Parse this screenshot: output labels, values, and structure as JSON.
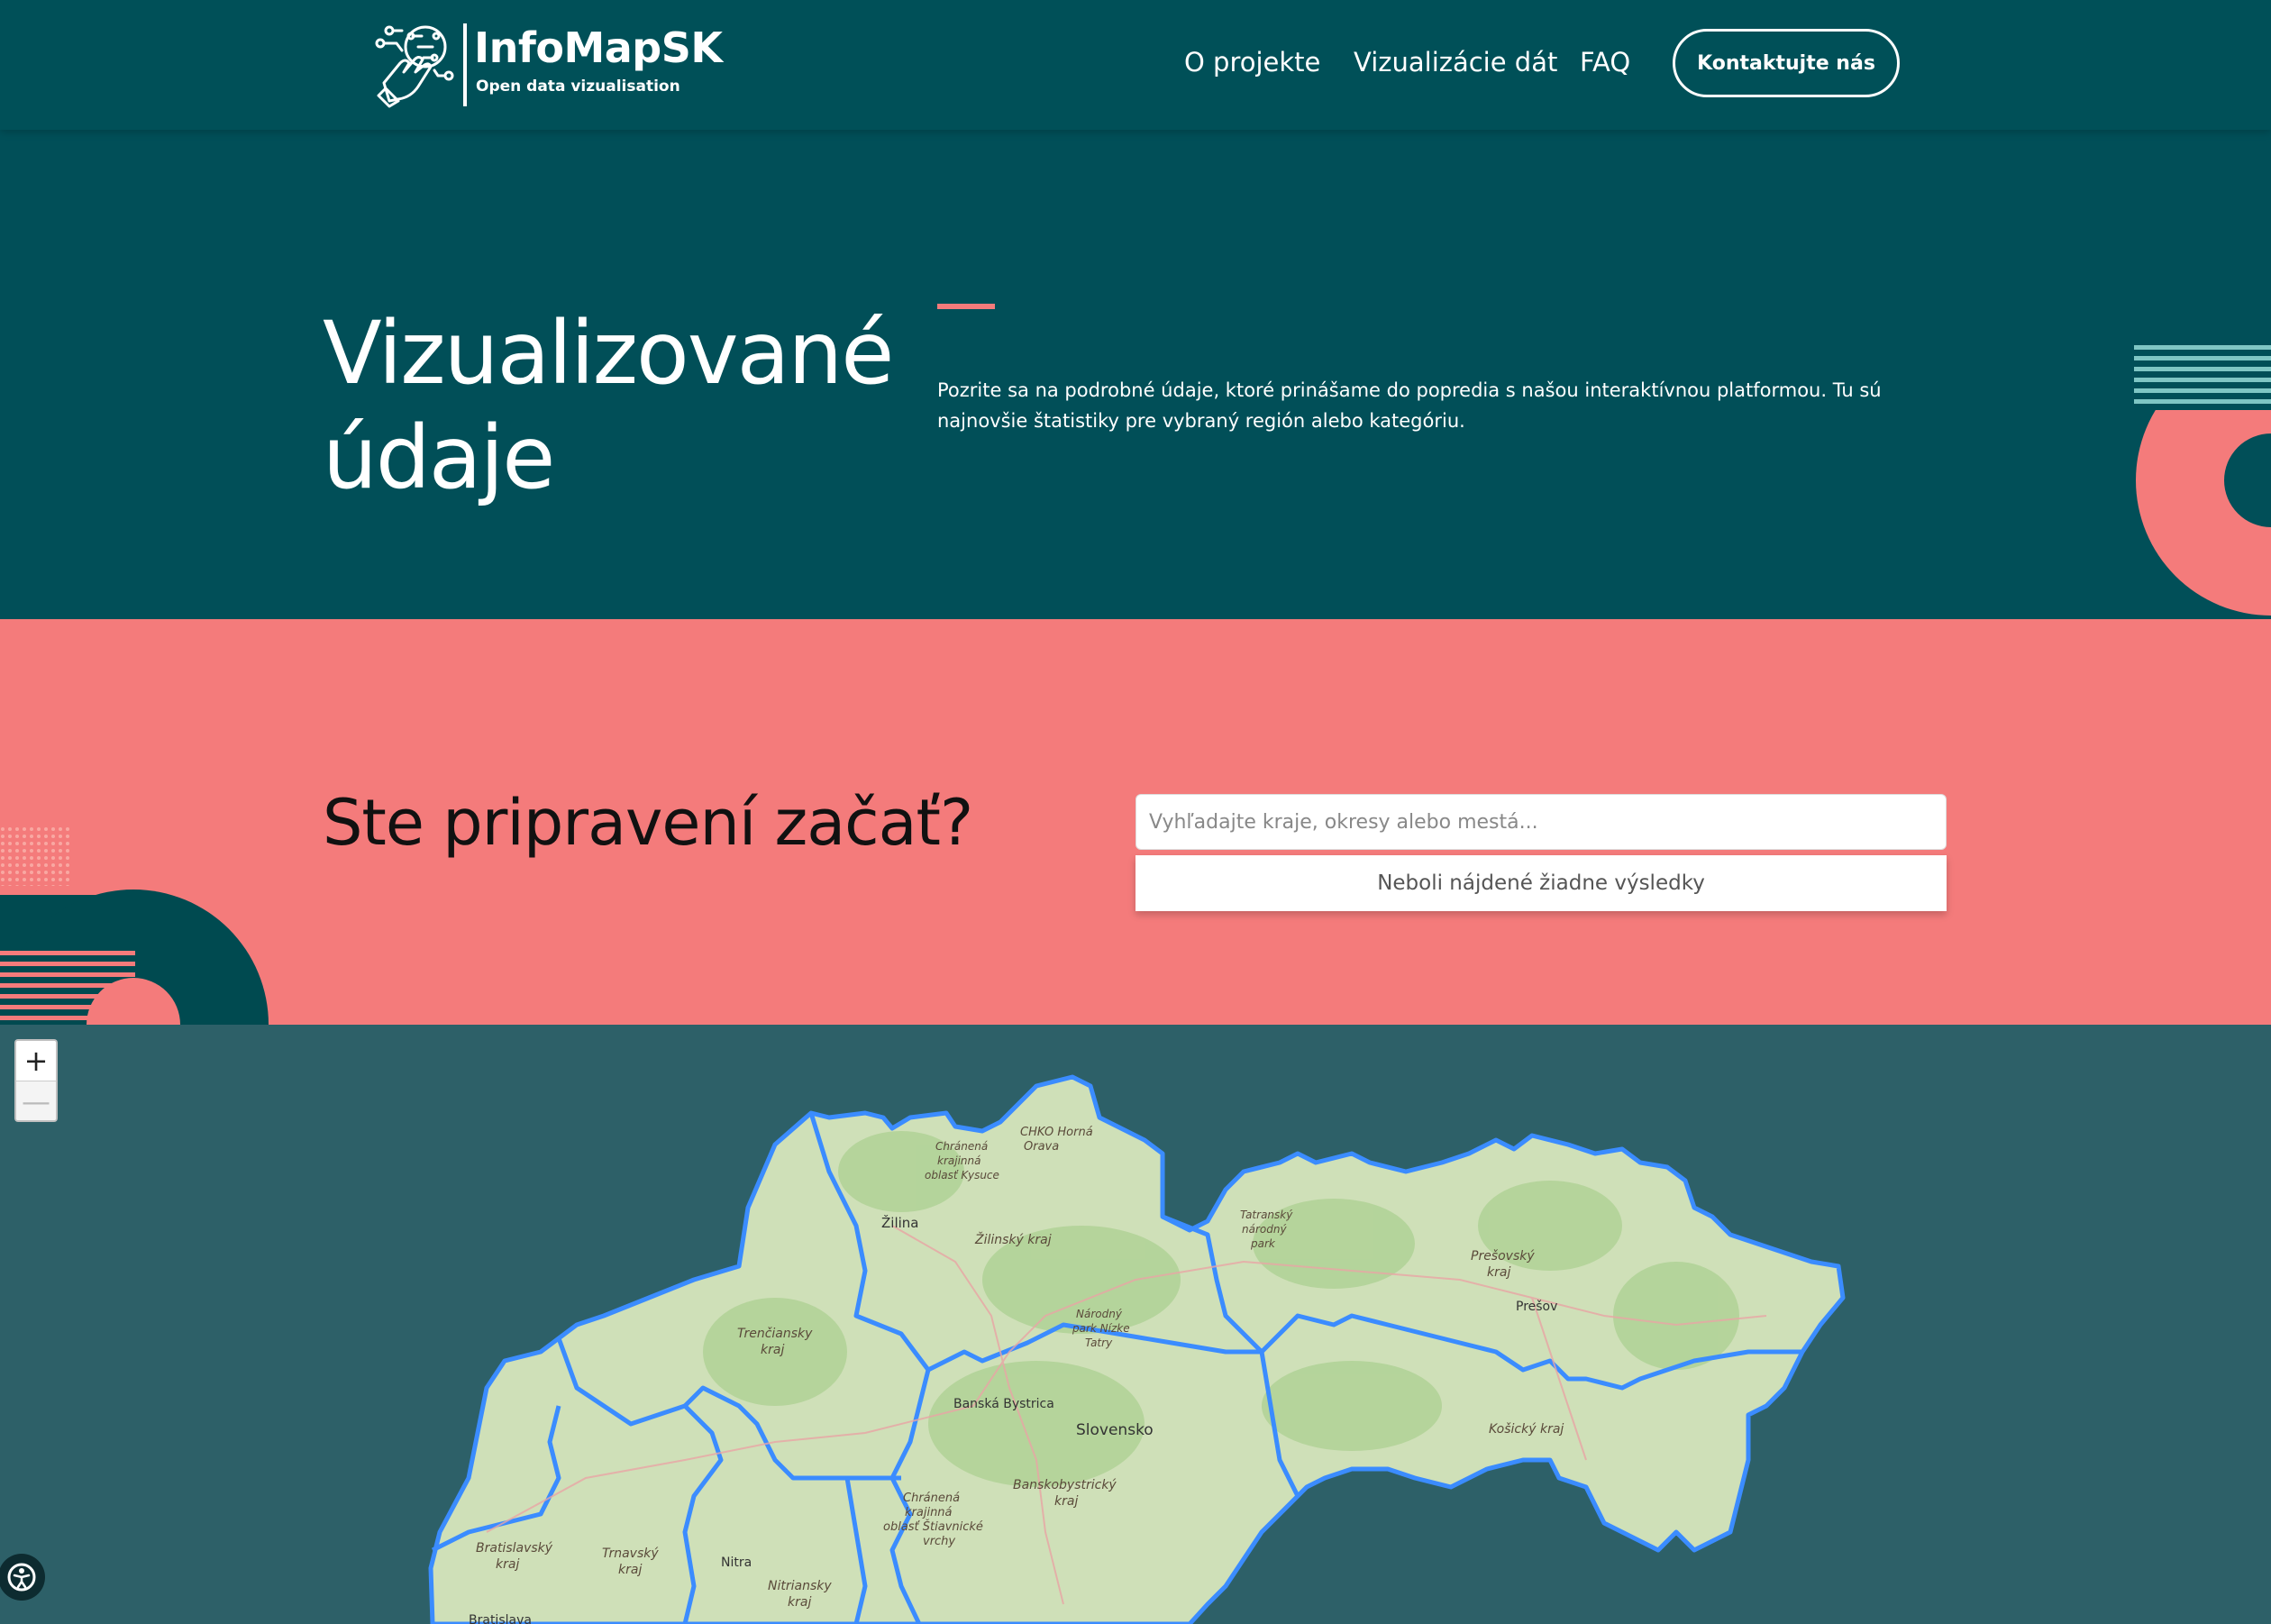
{
  "nav": {
    "logo_title": "InfoMapSK",
    "logo_subtitle": "Open data vizualisation",
    "links": [
      "O projekte",
      "Vizualizácie dát",
      "FAQ"
    ],
    "contact_button": "Kontaktujte nás"
  },
  "hero": {
    "title_line1": "Vizualizované",
    "title_line2": "údaje",
    "description": "Pozrite sa na podrobné údaje, ktoré prinášame do popredia s našou interaktívnou platformou. Tu sú najnovšie štatistiky pre vybraný región alebo kategóriu."
  },
  "cta": {
    "title": "Ste pripravení začať?",
    "search_placeholder": "Vyhľadajte kraje, okresy alebo mestá...",
    "no_results": "Neboli nájdené žiadne výsledky"
  },
  "map": {
    "zoom_in": "+",
    "zoom_out": "—",
    "labels": {
      "horna_orava": "CHKO Horná",
      "horna_orava2": "Orava",
      "kysuce1": "Chránená",
      "kysuce2": "krajinná",
      "kysuce3": "oblasť Kysuce",
      "zilina": "Žilina",
      "zilinsky": "Žilinský kraj",
      "tatransky1": "Tatranský",
      "tatransky2": "národný",
      "tatransky3": "park",
      "presovsky1": "Prešovský",
      "presovsky2": "kraj",
      "presov": "Prešov",
      "trenciansky1": "Trenčiansky",
      "trenciansky2": "kraj",
      "narodny1": "Národný",
      "narodny2": "park Nízke",
      "narodny3": "Tatry",
      "banska": "Banská Bystrica",
      "slovensko": "Slovensko",
      "kosicky": "Košický kraj",
      "banskobystricky1": "Banskobystrický",
      "banskobystricky2": "kraj",
      "chranena1": "Chránená",
      "chranena2": "krajinná",
      "chranena3": "oblasť Štiavnické",
      "chranena4": "vrchy",
      "bratislavsky1": "Bratislavský",
      "bratislavsky2": "kraj",
      "trnavsky1": "Trnavský",
      "trnavsky2": "kraj",
      "nitra": "Nitra",
      "nitriansky1": "Nitriansky",
      "nitriansky2": "kraj",
      "bratislava": "Bratislava"
    }
  },
  "colors": {
    "nav_bg": "#005058",
    "hero_bg": "#014f58",
    "accent_coral": "#f47b7b",
    "map_bg": "#2d6068",
    "region_border": "#3b8cff"
  },
  "icons": {
    "logo": "hand-circuit-icon",
    "accessibility": "accessibility-icon"
  }
}
